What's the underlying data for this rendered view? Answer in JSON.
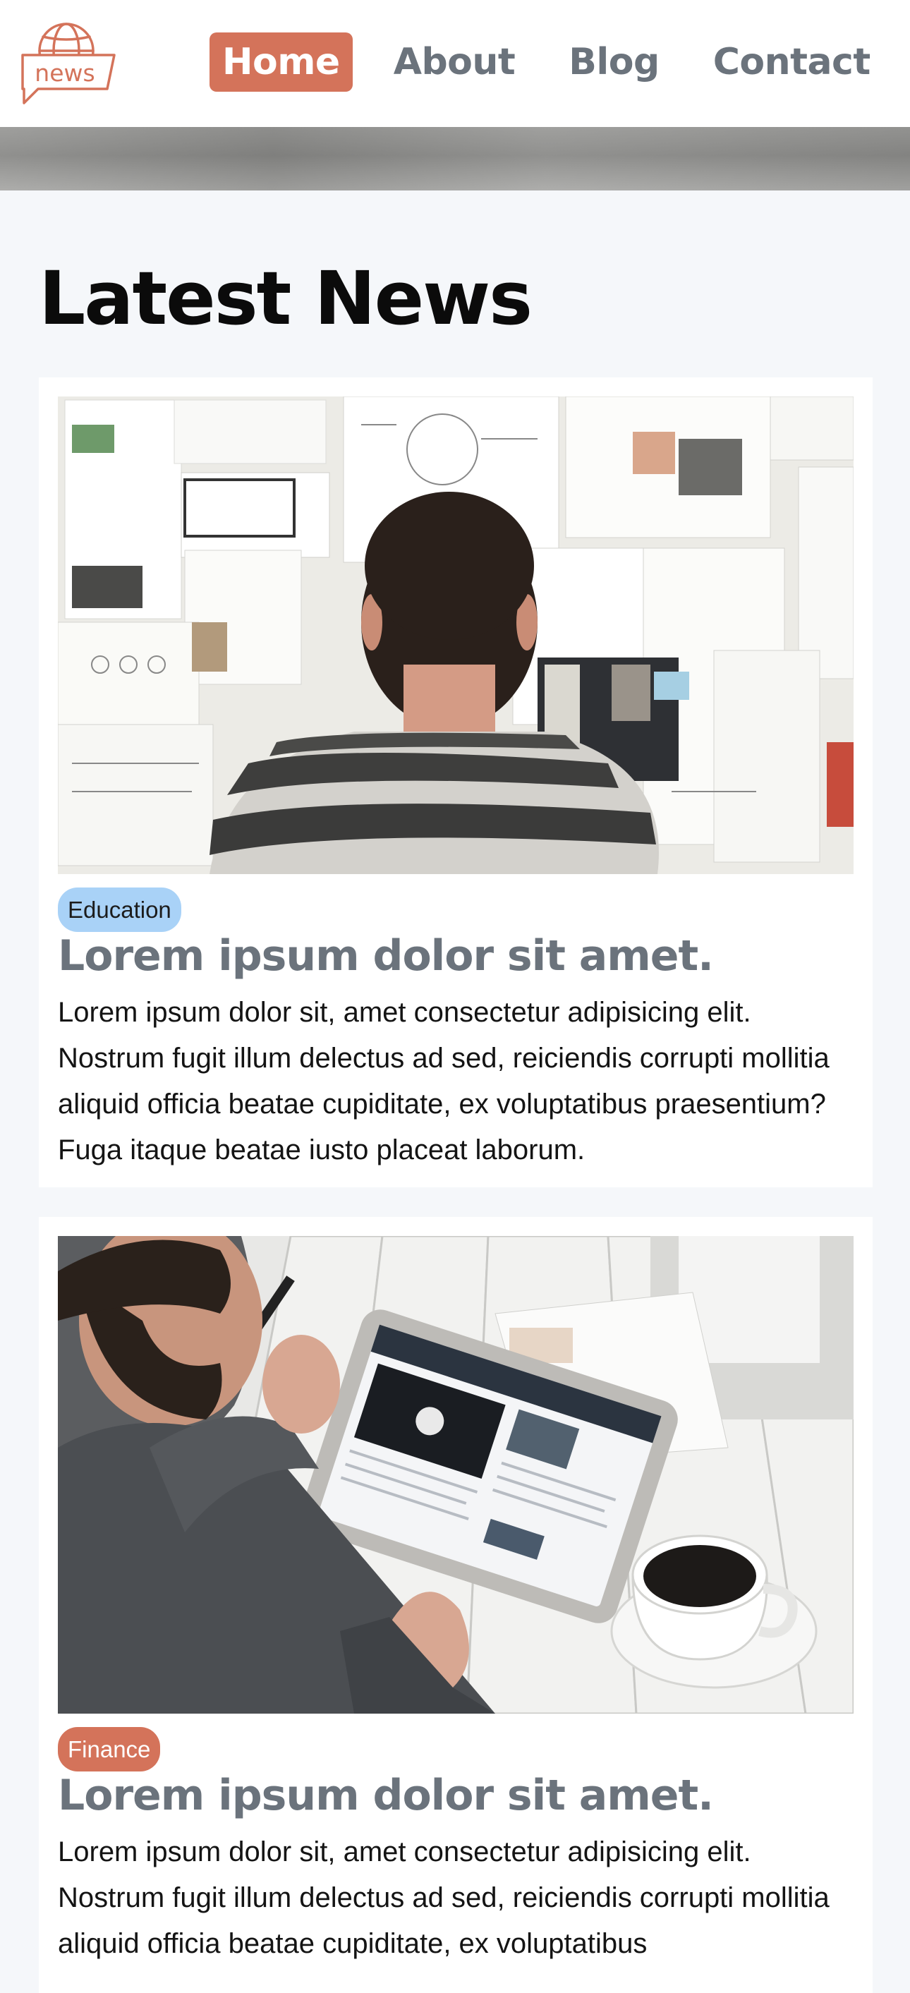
{
  "nav": {
    "logo_text": "news",
    "links": [
      {
        "label": "Home",
        "active": true
      },
      {
        "label": "About",
        "active": false
      },
      {
        "label": "Blog",
        "active": false
      },
      {
        "label": "Contact",
        "active": false
      }
    ]
  },
  "main": {
    "title": "Latest News",
    "articles": [
      {
        "image": "person-looking-at-moodboard-photo",
        "tag": "Education",
        "tag_color": "#a9d2f7",
        "title": "Lorem ipsum dolor sit amet.",
        "body": "Lorem ipsum dolor sit, amet consectetur adipisicing elit. Nostrum fugit illum delectus ad sed, reiciendis corrupti mollitia aliquid officia beatae cupiditate, ex voluptatibus praesentium? Fuga itaque beatae iusto placeat laborum."
      },
      {
        "image": "person-using-tablet-with-coffee-photo",
        "tag": "Finance",
        "tag_color": "#d4735a",
        "title": "Lorem ipsum dolor sit amet.",
        "body": "Lorem ipsum dolor sit, amet consectetur adipisicing elit. Nostrum fugit illum delectus ad sed, reiciendis corrupti mollitia aliquid officia beatae cupiditate, ex voluptatibus"
      }
    ]
  },
  "colors": {
    "accent": "#d4735a",
    "nav_text": "#6b737c",
    "page_bg": "#f5f7fa"
  }
}
